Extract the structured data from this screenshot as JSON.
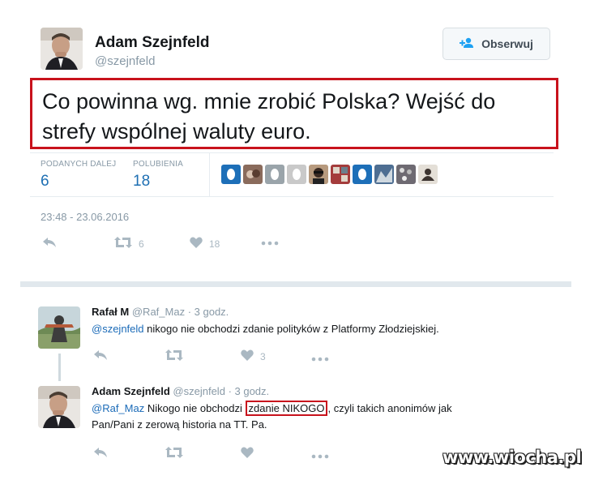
{
  "main_tweet": {
    "author_name": "Adam Szejnfeld",
    "author_handle": "@szejnfeld",
    "follow_label": "Obserwuj",
    "text": "Co powinna wg. mnie zrobić Polska? Wejść do strefy wspólnej waluty euro.",
    "stats": {
      "retweets_label": "PODANYCH DALEJ",
      "retweets_value": "6",
      "likes_label": "POLUBIENIA",
      "likes_value": "18"
    },
    "timestamp": "23:48 - 23.06.2016",
    "actions": {
      "retweet_count": "6",
      "like_count": "18"
    }
  },
  "replies": [
    {
      "author_name": "Rafał M",
      "author_handle": "@Raf_Maz",
      "time": "· 3 godz.",
      "mention": "@szejnfeld",
      "text": " nikogo nie obchodzi zdanie polityków z Platformy Złodziejskiej.",
      "like_count": "3"
    },
    {
      "author_name": "Adam Szejnfeld",
      "author_handle": "@szejnfeld",
      "time": "· 3 godz.",
      "mention": "@Raf_Maz",
      "text_before": " Nikogo nie obchodzi ",
      "text_highlight": "zdanie NIKOGO",
      "text_after": ", czyli takich anonimów jak",
      "text_line2": "Pan/Pani z zerową historia na TT. Pa."
    }
  ],
  "watermark": "www.wiocha.pl",
  "colors": {
    "highlight_border": "#c8121c",
    "link": "#1b6bb8",
    "stat_value": "#1e6fb3",
    "muted": "#8899a6"
  }
}
